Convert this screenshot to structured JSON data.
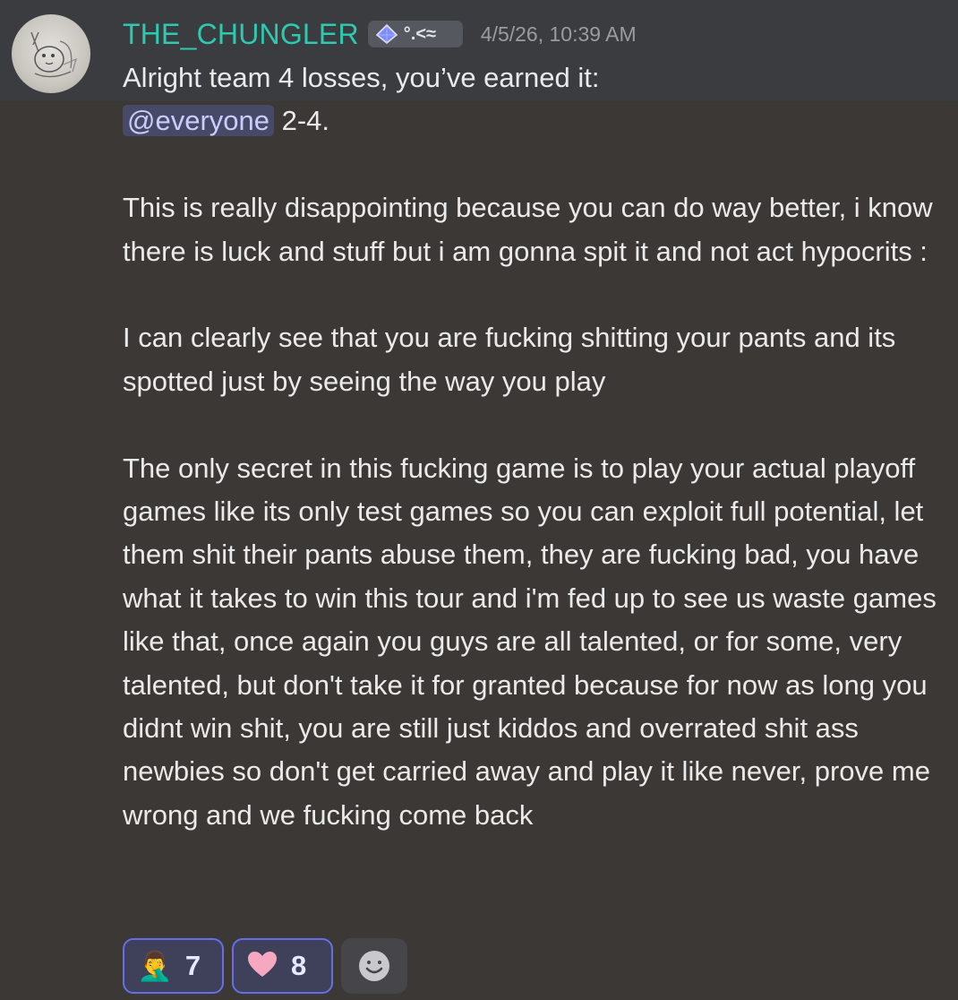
{
  "message": {
    "author": "THE_CHUNGLER",
    "tag": {
      "icon": "blue-crystal-icon",
      "text": "°.<≈"
    },
    "timestamp": "4/5/26, 10:39 AM",
    "line1": "Alright team 4 losses, you’ve earned it:",
    "mention": "@everyone",
    "line2_after": " 2-4.",
    "para1": "This is really disappointing because you can do way better, i know there is luck and stuff but i am gonna spit it and not act hypocrits :",
    "para2": "I can clearly see that you are fucking shitting your pants and its spotted just by seeing the way you play",
    "para3": "The only secret in this fucking game is to play your actual playoff games like its only test games so you can exploit full potential, let them shit their pants abuse them, they are fucking bad, you have what it takes to win this tour and i'm fed up to see us waste games like that, once again you guys are all talented, or for some, very talented, but don't take it for granted because for now as long you didnt win shit, you are still just kiddos and overrated shit ass newbies so don't get carried away and play it like never, prove me wrong and we fucking come back"
  },
  "reactions": [
    {
      "emoji": "🤦‍♂️",
      "icon": "facepalm-icon",
      "count": "7"
    },
    {
      "emoji": "🩷",
      "icon": "pink-heart-icon",
      "count": "8"
    }
  ],
  "add_reaction": {
    "icon": "add-reaction-smiley-icon"
  },
  "colors": {
    "username": "#2ecab0",
    "mention_bg": "#474a66",
    "reaction_border": "#6570e8",
    "background": "#3b3835"
  }
}
